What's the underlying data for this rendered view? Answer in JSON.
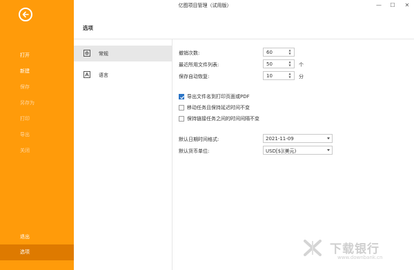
{
  "app": {
    "title": "亿图项目管理（试用版）"
  },
  "window_controls": {
    "minimize": "—",
    "maximize": "☐",
    "close": "✕"
  },
  "sidebar": {
    "items": [
      {
        "label": "打开"
      },
      {
        "label": "新建"
      },
      {
        "label": "保存"
      },
      {
        "label": "另存为"
      },
      {
        "label": "打印"
      },
      {
        "label": "导出"
      },
      {
        "label": "关闭"
      },
      {
        "label": "退出"
      },
      {
        "label": "选项"
      }
    ]
  },
  "page": {
    "title": "选项"
  },
  "categories": [
    {
      "label": "常规",
      "icon": "gear-icon"
    },
    {
      "label": "语言",
      "icon": "language-icon"
    }
  ],
  "general": {
    "undo_label": "撤销次数:",
    "undo_value": "60",
    "recent_label": "最近所用文件列表:",
    "recent_value": "50",
    "recent_unit": "个",
    "autosave_label": "保存自动恢复:",
    "autosave_value": "10",
    "autosave_unit": "分",
    "checkboxes": [
      {
        "label": "导出文件名到打印页面或PDF",
        "checked": true
      },
      {
        "label": "移动任务且保持延迟时间不变",
        "checked": false
      },
      {
        "label": "保持链接任务之间的时间间隔不变",
        "checked": false
      }
    ],
    "date_label": "默认日期时间格式:",
    "date_value": "2021-11-09",
    "currency_label": "默认货币单位:",
    "currency_value": "USD[$](美元)"
  },
  "watermark": {
    "text": "下载银行",
    "url": "www.downbank.cn"
  },
  "colors": {
    "sidebar": "#ff9b0a",
    "sidebar_active": "#de7a00",
    "checkbox_on": "#2a74c6"
  }
}
